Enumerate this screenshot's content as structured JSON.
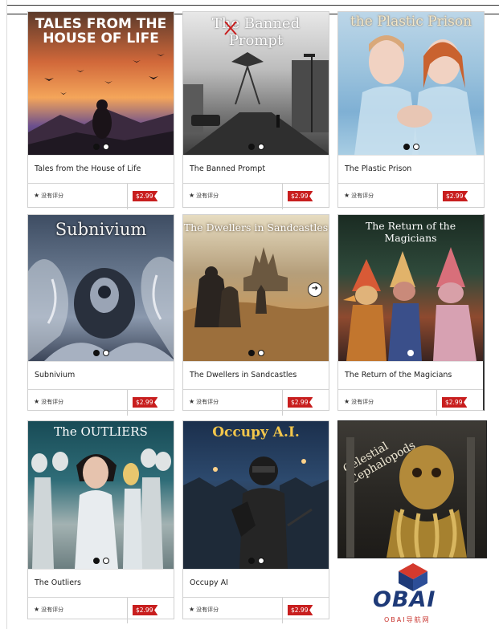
{
  "cards": [
    {
      "title": "Tales from the House of Life",
      "rating": "没有评分",
      "price": "$2.99",
      "art_title": "TALES FROM THE HOUSE OF LIFE"
    },
    {
      "title": "The Banned Prompt",
      "rating": "没有评分",
      "price": "$2.99",
      "art_title": "The Banned Prompt"
    },
    {
      "title": "The Plastic Prison",
      "rating": "没有评分",
      "price": "$2.99",
      "art_title": "the Plastic Prison"
    },
    {
      "title": "Subnivium",
      "rating": "没有评分",
      "price": "$2.99",
      "art_title": "Subnivium"
    },
    {
      "title": "The Dwellers in Sandcastles",
      "rating": "没有评分",
      "price": "$2.99",
      "art_title": "The Dwellers in Sandcastles"
    },
    {
      "title": "The Return of the Magicians",
      "rating": "没有评分",
      "price": "$2.99",
      "art_title": "The Return of the Magicians"
    },
    {
      "title": "The Outliers",
      "rating": "没有评分",
      "price": "$2.99",
      "art_title": "The OUTLIERS"
    },
    {
      "title": "Occupy AI",
      "rating": "没有评分",
      "price": "$2.99",
      "art_title": "Occupy A.I."
    }
  ],
  "featured": {
    "art_title": "Celestial Cephalopods"
  },
  "logo": {
    "word": "OBAI",
    "subtitle": "OBAI导航网"
  },
  "colors": {
    "price_tag": "#c81e1e",
    "logo_blue": "#1e3a78",
    "logo_red": "#c8342e"
  },
  "icons": {
    "rating": "star-icon",
    "next": "arrow-right-icon"
  }
}
